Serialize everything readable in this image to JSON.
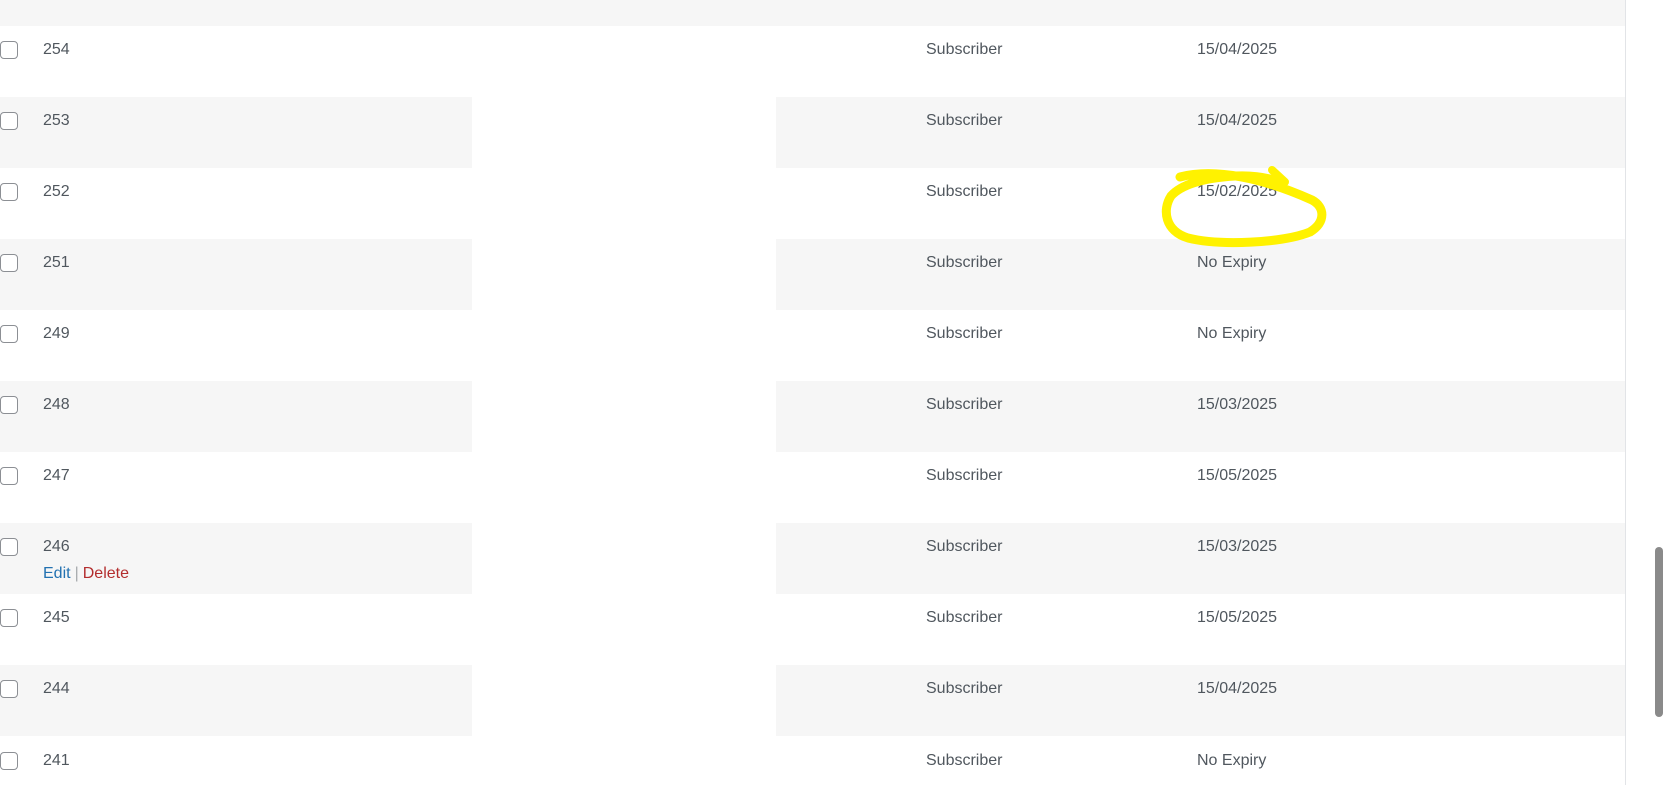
{
  "rows": [
    {
      "id": "254",
      "role": "Subscriber",
      "expiry": "15/04/2025"
    },
    {
      "id": "253",
      "role": "Subscriber",
      "expiry": "15/04/2025"
    },
    {
      "id": "252",
      "role": "Subscriber",
      "expiry": "15/02/2025"
    },
    {
      "id": "251",
      "role": "Subscriber",
      "expiry": "No Expiry"
    },
    {
      "id": "249",
      "role": "Subscriber",
      "expiry": "No Expiry"
    },
    {
      "id": "248",
      "role": "Subscriber",
      "expiry": "15/03/2025"
    },
    {
      "id": "247",
      "role": "Subscriber",
      "expiry": "15/05/2025"
    },
    {
      "id": "246",
      "role": "Subscriber",
      "expiry": "15/03/2025"
    },
    {
      "id": "245",
      "role": "Subscriber",
      "expiry": "15/05/2025"
    },
    {
      "id": "244",
      "role": "Subscriber",
      "expiry": "15/04/2025"
    },
    {
      "id": "241",
      "role": "Subscriber",
      "expiry": "No Expiry"
    }
  ],
  "row_actions": {
    "edit_label": "Edit",
    "separator": "|",
    "delete_label": "Delete"
  },
  "colors": {
    "link": "#2271b1",
    "delete": "#b32d2e",
    "highlight": "#fff200",
    "stripe": "#f6f6f6"
  }
}
